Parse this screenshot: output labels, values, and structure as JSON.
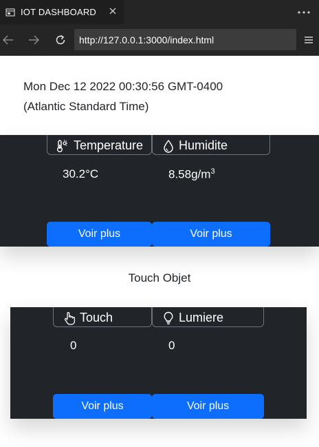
{
  "browser": {
    "tab_title": "IOT DASHBOARD",
    "url": "http://127.0.0.1:3000/index.html"
  },
  "page": {
    "date_line1": "Mon Dec 12 2022 00:30:56 GMT-0400",
    "date_line2": "(Atlantic Standard Time)",
    "sensors": [
      {
        "title": "Temperature",
        "icon": "thermometer-sun-icon",
        "value": "30.2",
        "unit": "°C",
        "button": "Voir plus"
      },
      {
        "title": "Humidite",
        "icon": "droplet-icon",
        "value": "8.58",
        "unit": "g/m",
        "unit_sup": "3",
        "button": "Voir plus"
      }
    ],
    "objects_heading": "Touch Objet",
    "objects": [
      {
        "title": "Touch",
        "icon": "hand-pointer-icon",
        "value": "0",
        "button": "Voir plus"
      },
      {
        "title": "Lumiere",
        "icon": "lightbulb-icon",
        "value": "0",
        "button": "Voir plus"
      }
    ]
  },
  "colors": {
    "chrome_bg": "#252526",
    "card_bg": "#212529",
    "primary_button": "#0d6efd"
  }
}
